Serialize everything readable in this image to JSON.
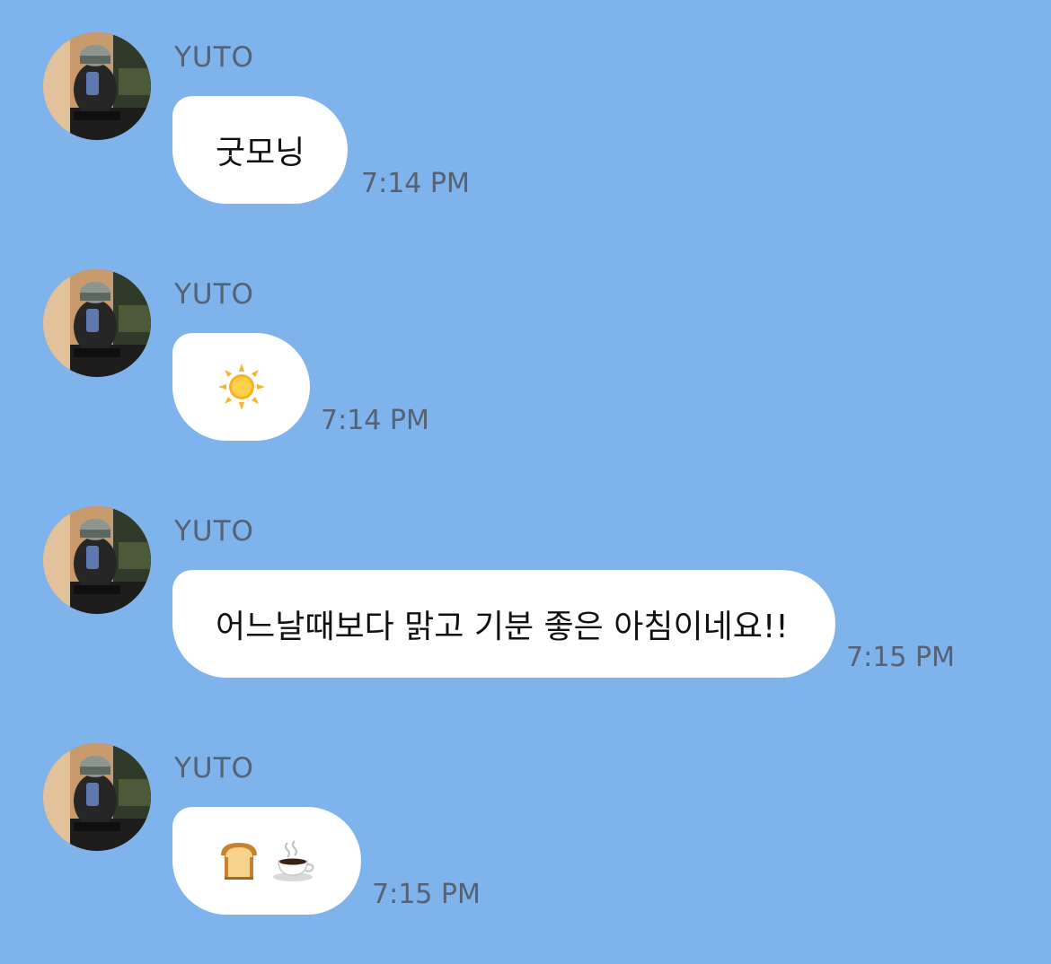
{
  "messages": [
    {
      "sender": "YUTO",
      "text": "굿모닝",
      "time": "7:14 PM"
    },
    {
      "sender": "YUTO",
      "emoji": [
        "sun-emoji"
      ],
      "time": "7:14 PM"
    },
    {
      "sender": "YUTO",
      "text": "어느날때보다 맑고 기분 좋은 아침이네요!!",
      "time": "7:15 PM"
    },
    {
      "sender": "YUTO",
      "emoji": [
        "bread-emoji",
        "coffee-emoji"
      ],
      "time": "7:15 PM"
    }
  ],
  "colors": {
    "background": "#7fb3ec",
    "bubble": "#ffffff",
    "meta_text": "#566272"
  }
}
